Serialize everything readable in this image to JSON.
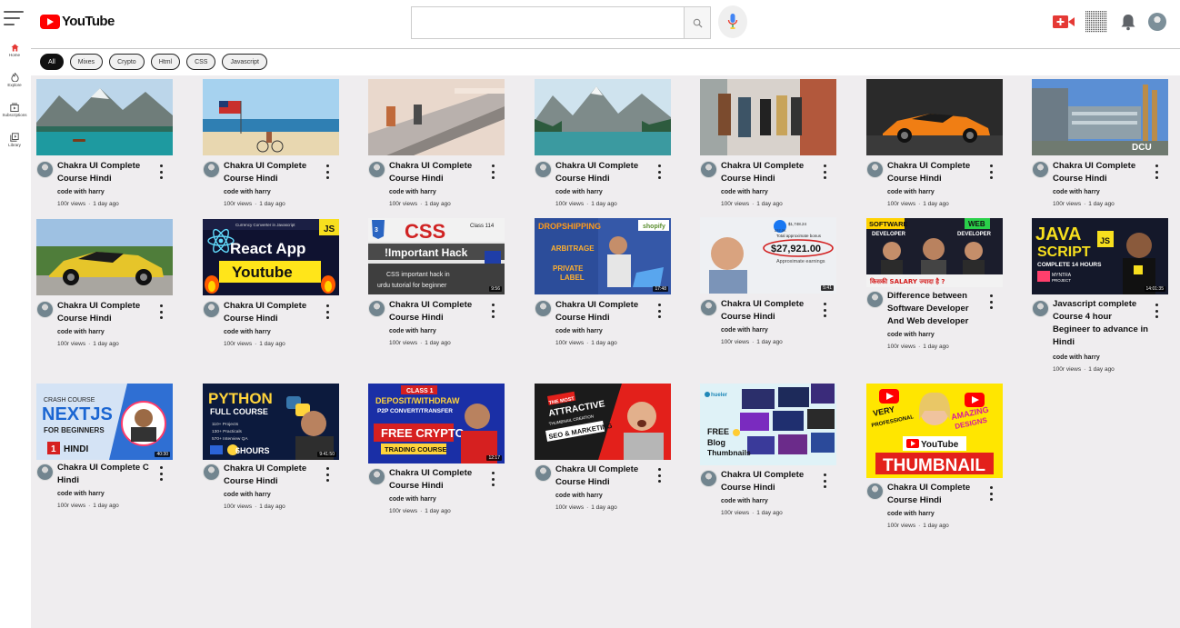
{
  "header": {
    "logo_text": "YouTube",
    "search_placeholder": "",
    "icons": {
      "menu": "hamburger-menu-icon",
      "search": "search-icon",
      "mic": "microphone-icon",
      "create": "video-create-icon",
      "apps": "apps-grid-icon",
      "notifications": "bell-icon",
      "avatar": "user-avatar"
    },
    "brand_color": "#ff0000"
  },
  "sidebar": {
    "items": [
      {
        "label": "Home",
        "icon": "home-icon"
      },
      {
        "label": "Explore",
        "icon": "explore-icon"
      },
      {
        "label": "Subscriptions",
        "icon": "subscriptions-icon"
      },
      {
        "label": "Library",
        "icon": "library-icon"
      }
    ]
  },
  "chips": [
    "All",
    "Mixes",
    "Crypto",
    "Html",
    "CSS",
    "Javascript"
  ],
  "videos": [
    {
      "title": "Chakra UI Complete Course Hindi",
      "channel": "code with harry",
      "views": "100r views",
      "age": "1 day ago"
    },
    {
      "title": "Chakra UI Complete Course Hindi",
      "channel": "code with harry",
      "views": "100r views",
      "age": "1 day ago"
    },
    {
      "title": "Chakra UI Complete Course Hindi",
      "channel": "code with harry",
      "views": "100r views",
      "age": "1 day ago"
    },
    {
      "title": "Chakra UI Complete Course Hindi",
      "channel": "code with harry",
      "views": "100r views",
      "age": "1 day ago"
    },
    {
      "title": "Chakra UI Complete Course Hindi",
      "channel": "code with harry",
      "views": "100r views",
      "age": "1 day ago"
    },
    {
      "title": "Chakra UI Complete Course Hindi",
      "channel": "code with harry",
      "views": "100r views",
      "age": "1 day ago"
    },
    {
      "title": "Chakra UI Complete Course Hindi",
      "channel": "code with harry",
      "views": "100r views",
      "age": "1 day ago"
    },
    {
      "title": "Chakra UI Complete Course Hindi",
      "channel": "code with harry",
      "views": "100r views",
      "age": "1 day ago"
    },
    {
      "title": "Chakra UI Complete Course Hindi",
      "channel": "code with harry",
      "views": "100r views",
      "age": "1 day ago",
      "thumb_text": [
        "React App",
        "Youtube"
      ],
      "thumb_top": "Currency Converter in Javascript",
      "thumb_badge": "JS"
    },
    {
      "title": "Chakra UI Complete Course Hindi",
      "channel": "code with harry",
      "views": "100r views",
      "age": "1 day ago",
      "thumb_text": [
        "CSS",
        "!Important Hack",
        "CSS important hack in",
        "urdu tutorial for beginner"
      ],
      "thumb_badge": "Class 114",
      "duration": "9:56"
    },
    {
      "title": "Chakra UI Complete Course Hindi",
      "channel": "code with harry",
      "views": "100r views",
      "age": "1 day ago",
      "thumb_text": [
        "DROPSHIPPING",
        "ARBITRAGE",
        "PRIVATE",
        "LABEL"
      ],
      "thumb_badge": "shopify",
      "duration": "17:48"
    },
    {
      "title": "Chakra UI Complete Course Hindi",
      "channel": "code with harry",
      "views": "100r views",
      "age": "1 day ago",
      "thumb_text": [
        "$27,921.00",
        "Approximate earnings",
        "Total approximate bonus",
        "$1,748.24",
        "237.2K"
      ],
      "duration": "5:41"
    },
    {
      "title": "Difference between Software Developer And Web developer",
      "channel": "code with harry",
      "views": "100r views",
      "age": "1 day ago",
      "thumb_text": [
        "SOFTWARE",
        "DEVELOPER",
        "WEB",
        "DEVELOPER",
        "किसकी SALARY ज्यादा है ?"
      ]
    },
    {
      "title": "Javascript complete Course 4 hour Begineer to advance in Hindi",
      "channel": "code with harry",
      "views": "100r views",
      "age": "1 day ago",
      "thumb_text": [
        "JAVA",
        "SCRIPT",
        "COMPLETE 14 HOURS",
        "JS",
        "MYNTRA",
        "PROJECT"
      ],
      "duration": "14:01:35"
    },
    {
      "title": "Chakra UI Complete C Hindi",
      "channel": "code with harry",
      "views": "100r views",
      "age": "1 day ago",
      "thumb_text": [
        "CRASH COURSE",
        "NEXTJS",
        "FOR BEGINNERS",
        "1",
        "HINDI"
      ],
      "duration": "40:30"
    },
    {
      "title": "Chakra UI Complete Course Hindi",
      "channel": "code with harry",
      "views": "100r views",
      "age": "1 day ago",
      "thumb_text": [
        "PYTHON",
        "FULL COURSE",
        "110+ Projects",
        "130+ Practicals",
        "570+ Interview QA",
        "6HOURS"
      ],
      "duration": "9:41:50"
    },
    {
      "title": "Chakra UI Complete Course Hindi",
      "channel": "code with harry",
      "views": "100r views",
      "age": "1 day ago",
      "thumb_text": [
        "CLASS 1",
        "DEPOSIT/WITHDRAW",
        "P2P CONVERT/TRANSFER",
        "FREE CRYPTO",
        "TRADING COURSE"
      ],
      "duration": "12:17"
    },
    {
      "title": "Chakra UI Complete Course Hindi",
      "channel": "code with harry",
      "views": "100r views",
      "age": "1 day ago",
      "thumb_text": [
        "THE MOST",
        "ATTRACTIVE",
        "THUMBNAIL CREATION",
        "SEO & MARKETING"
      ]
    },
    {
      "title": "Chakra UI Complete Course Hindi",
      "channel": "code with harry",
      "views": "100r views",
      "age": "1 day ago",
      "thumb_text": [
        "hueler",
        "FREE",
        "Blog",
        "Thumbnails"
      ]
    },
    {
      "title": "Chakra UI Complete Course Hindi",
      "channel": "code with harry",
      "views": "100r views",
      "age": "1 day ago",
      "thumb_text": [
        "VERY",
        "PROFESSIONAL",
        "AMAZING",
        "DESIGNS",
        "YouTube",
        "THUMBNAIL"
      ]
    }
  ]
}
